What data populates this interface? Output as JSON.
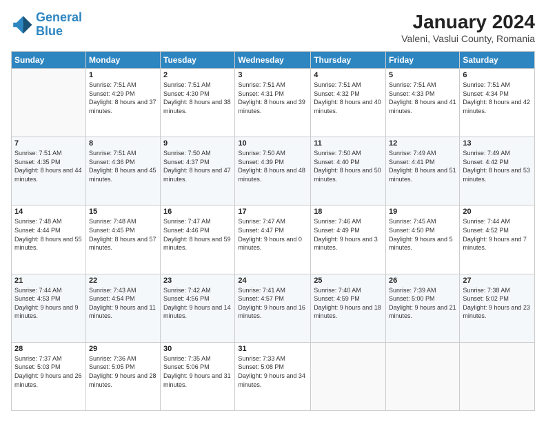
{
  "header": {
    "logo_line1": "General",
    "logo_line2": "Blue",
    "title": "January 2024",
    "subtitle": "Valeni, Vaslui County, Romania"
  },
  "weekdays": [
    "Sunday",
    "Monday",
    "Tuesday",
    "Wednesday",
    "Thursday",
    "Friday",
    "Saturday"
  ],
  "weeks": [
    [
      {
        "day": "",
        "sunrise": "",
        "sunset": "",
        "daylight": ""
      },
      {
        "day": "1",
        "sunrise": "Sunrise: 7:51 AM",
        "sunset": "Sunset: 4:29 PM",
        "daylight": "Daylight: 8 hours and 37 minutes."
      },
      {
        "day": "2",
        "sunrise": "Sunrise: 7:51 AM",
        "sunset": "Sunset: 4:30 PM",
        "daylight": "Daylight: 8 hours and 38 minutes."
      },
      {
        "day": "3",
        "sunrise": "Sunrise: 7:51 AM",
        "sunset": "Sunset: 4:31 PM",
        "daylight": "Daylight: 8 hours and 39 minutes."
      },
      {
        "day": "4",
        "sunrise": "Sunrise: 7:51 AM",
        "sunset": "Sunset: 4:32 PM",
        "daylight": "Daylight: 8 hours and 40 minutes."
      },
      {
        "day": "5",
        "sunrise": "Sunrise: 7:51 AM",
        "sunset": "Sunset: 4:33 PM",
        "daylight": "Daylight: 8 hours and 41 minutes."
      },
      {
        "day": "6",
        "sunrise": "Sunrise: 7:51 AM",
        "sunset": "Sunset: 4:34 PM",
        "daylight": "Daylight: 8 hours and 42 minutes."
      }
    ],
    [
      {
        "day": "7",
        "sunrise": "Sunrise: 7:51 AM",
        "sunset": "Sunset: 4:35 PM",
        "daylight": "Daylight: 8 hours and 44 minutes."
      },
      {
        "day": "8",
        "sunrise": "Sunrise: 7:51 AM",
        "sunset": "Sunset: 4:36 PM",
        "daylight": "Daylight: 8 hours and 45 minutes."
      },
      {
        "day": "9",
        "sunrise": "Sunrise: 7:50 AM",
        "sunset": "Sunset: 4:37 PM",
        "daylight": "Daylight: 8 hours and 47 minutes."
      },
      {
        "day": "10",
        "sunrise": "Sunrise: 7:50 AM",
        "sunset": "Sunset: 4:39 PM",
        "daylight": "Daylight: 8 hours and 48 minutes."
      },
      {
        "day": "11",
        "sunrise": "Sunrise: 7:50 AM",
        "sunset": "Sunset: 4:40 PM",
        "daylight": "Daylight: 8 hours and 50 minutes."
      },
      {
        "day": "12",
        "sunrise": "Sunrise: 7:49 AM",
        "sunset": "Sunset: 4:41 PM",
        "daylight": "Daylight: 8 hours and 51 minutes."
      },
      {
        "day": "13",
        "sunrise": "Sunrise: 7:49 AM",
        "sunset": "Sunset: 4:42 PM",
        "daylight": "Daylight: 8 hours and 53 minutes."
      }
    ],
    [
      {
        "day": "14",
        "sunrise": "Sunrise: 7:48 AM",
        "sunset": "Sunset: 4:44 PM",
        "daylight": "Daylight: 8 hours and 55 minutes."
      },
      {
        "day": "15",
        "sunrise": "Sunrise: 7:48 AM",
        "sunset": "Sunset: 4:45 PM",
        "daylight": "Daylight: 8 hours and 57 minutes."
      },
      {
        "day": "16",
        "sunrise": "Sunrise: 7:47 AM",
        "sunset": "Sunset: 4:46 PM",
        "daylight": "Daylight: 8 hours and 59 minutes."
      },
      {
        "day": "17",
        "sunrise": "Sunrise: 7:47 AM",
        "sunset": "Sunset: 4:47 PM",
        "daylight": "Daylight: 9 hours and 0 minutes."
      },
      {
        "day": "18",
        "sunrise": "Sunrise: 7:46 AM",
        "sunset": "Sunset: 4:49 PM",
        "daylight": "Daylight: 9 hours and 3 minutes."
      },
      {
        "day": "19",
        "sunrise": "Sunrise: 7:45 AM",
        "sunset": "Sunset: 4:50 PM",
        "daylight": "Daylight: 9 hours and 5 minutes."
      },
      {
        "day": "20",
        "sunrise": "Sunrise: 7:44 AM",
        "sunset": "Sunset: 4:52 PM",
        "daylight": "Daylight: 9 hours and 7 minutes."
      }
    ],
    [
      {
        "day": "21",
        "sunrise": "Sunrise: 7:44 AM",
        "sunset": "Sunset: 4:53 PM",
        "daylight": "Daylight: 9 hours and 9 minutes."
      },
      {
        "day": "22",
        "sunrise": "Sunrise: 7:43 AM",
        "sunset": "Sunset: 4:54 PM",
        "daylight": "Daylight: 9 hours and 11 minutes."
      },
      {
        "day": "23",
        "sunrise": "Sunrise: 7:42 AM",
        "sunset": "Sunset: 4:56 PM",
        "daylight": "Daylight: 9 hours and 14 minutes."
      },
      {
        "day": "24",
        "sunrise": "Sunrise: 7:41 AM",
        "sunset": "Sunset: 4:57 PM",
        "daylight": "Daylight: 9 hours and 16 minutes."
      },
      {
        "day": "25",
        "sunrise": "Sunrise: 7:40 AM",
        "sunset": "Sunset: 4:59 PM",
        "daylight": "Daylight: 9 hours and 18 minutes."
      },
      {
        "day": "26",
        "sunrise": "Sunrise: 7:39 AM",
        "sunset": "Sunset: 5:00 PM",
        "daylight": "Daylight: 9 hours and 21 minutes."
      },
      {
        "day": "27",
        "sunrise": "Sunrise: 7:38 AM",
        "sunset": "Sunset: 5:02 PM",
        "daylight": "Daylight: 9 hours and 23 minutes."
      }
    ],
    [
      {
        "day": "28",
        "sunrise": "Sunrise: 7:37 AM",
        "sunset": "Sunset: 5:03 PM",
        "daylight": "Daylight: 9 hours and 26 minutes."
      },
      {
        "day": "29",
        "sunrise": "Sunrise: 7:36 AM",
        "sunset": "Sunset: 5:05 PM",
        "daylight": "Daylight: 9 hours and 28 minutes."
      },
      {
        "day": "30",
        "sunrise": "Sunrise: 7:35 AM",
        "sunset": "Sunset: 5:06 PM",
        "daylight": "Daylight: 9 hours and 31 minutes."
      },
      {
        "day": "31",
        "sunrise": "Sunrise: 7:33 AM",
        "sunset": "Sunset: 5:08 PM",
        "daylight": "Daylight: 9 hours and 34 minutes."
      },
      {
        "day": "",
        "sunrise": "",
        "sunset": "",
        "daylight": ""
      },
      {
        "day": "",
        "sunrise": "",
        "sunset": "",
        "daylight": ""
      },
      {
        "day": "",
        "sunrise": "",
        "sunset": "",
        "daylight": ""
      }
    ]
  ]
}
